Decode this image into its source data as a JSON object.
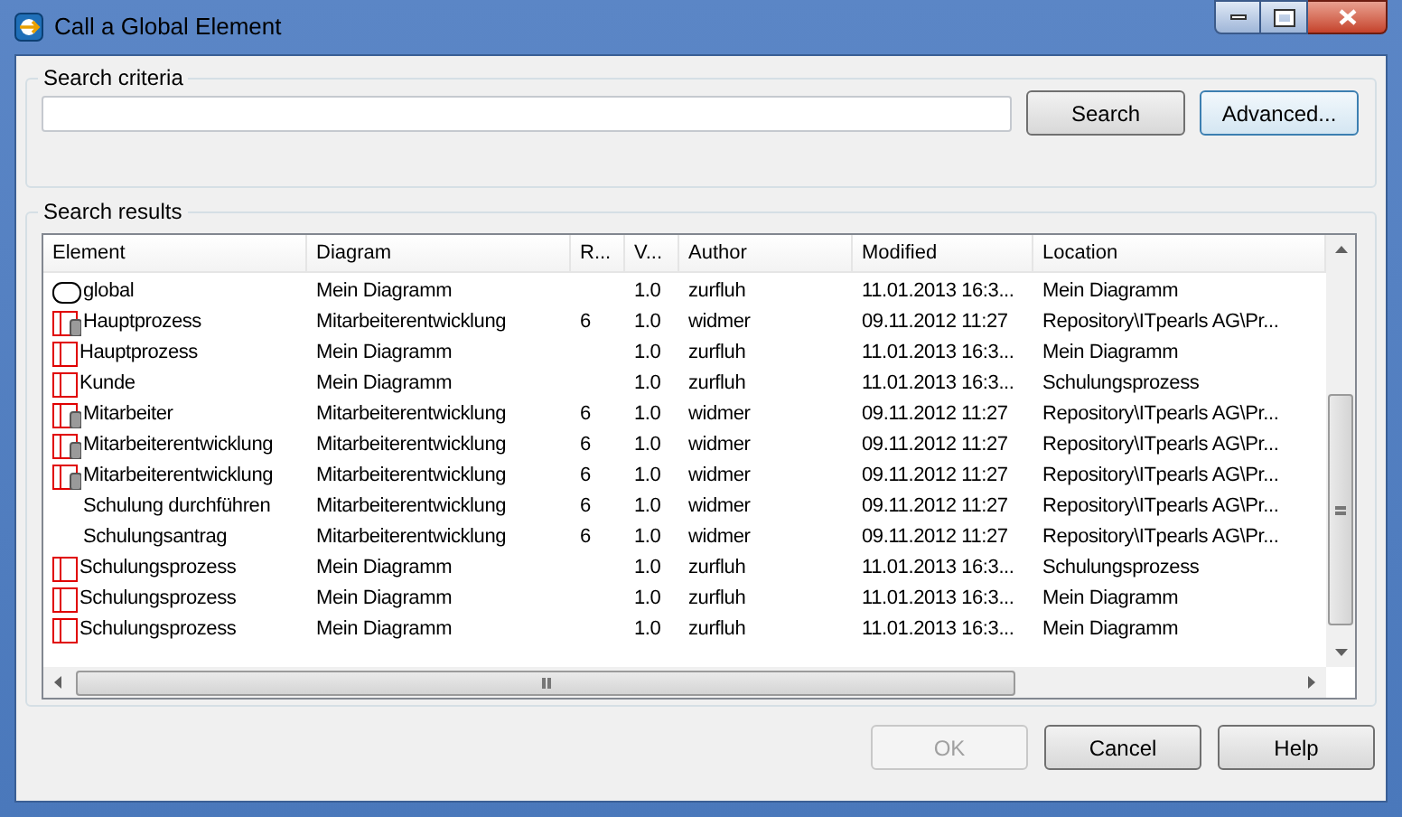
{
  "window": {
    "title": "Call a Global Element"
  },
  "search_criteria": {
    "label": "Search criteria",
    "search_button": "Search",
    "advanced_button": "Advanced..."
  },
  "search_results": {
    "label": "Search results",
    "columns": [
      "Element",
      "Diagram",
      "R...",
      "V...",
      "Author",
      "Modified",
      "Location"
    ],
    "rows": [
      {
        "kind": "terminator",
        "cells": [
          "global",
          "Mein Diagramm",
          "",
          "1.0",
          "zurfluh",
          "11.01.2013 16:3...",
          "Mein Diagramm"
        ]
      },
      {
        "kind": "linked-process",
        "cells": [
          "Hauptprozess",
          "Mitarbeiterentwicklung",
          "6",
          "1.0",
          "widmer",
          "09.11.2012 11:27",
          "Repository\\ITpearls AG\\Pr..."
        ]
      },
      {
        "kind": "process",
        "cells": [
          "Hauptprozess",
          "Mein Diagramm",
          "",
          "1.0",
          "zurfluh",
          "11.01.2013 16:3...",
          "Mein Diagramm"
        ]
      },
      {
        "kind": "process",
        "cells": [
          "Kunde",
          "Mein Diagramm",
          "",
          "1.0",
          "zurfluh",
          "11.01.2013 16:3...",
          "Schulungsprozess"
        ]
      },
      {
        "kind": "linked-process",
        "cells": [
          "Mitarbeiter",
          "Mitarbeiterentwicklung",
          "6",
          "1.0",
          "widmer",
          "09.11.2012 11:27",
          "Repository\\ITpearls AG\\Pr..."
        ]
      },
      {
        "kind": "linked-process",
        "cells": [
          "Mitarbeiterentwicklung",
          "Mitarbeiterentwicklung",
          "6",
          "1.0",
          "widmer",
          "09.11.2012 11:27",
          "Repository\\ITpearls AG\\Pr..."
        ]
      },
      {
        "kind": "linked-process",
        "cells": [
          "Mitarbeiterentwicklung",
          "Mitarbeiterentwicklung",
          "6",
          "1.0",
          "widmer",
          "09.11.2012 11:27",
          "Repository\\ITpearls AG\\Pr..."
        ]
      },
      {
        "kind": "none",
        "cells": [
          "Schulung durchführen",
          "Mitarbeiterentwicklung",
          "6",
          "1.0",
          "widmer",
          "09.11.2012 11:27",
          "Repository\\ITpearls AG\\Pr..."
        ]
      },
      {
        "kind": "none",
        "cells": [
          "Schulungsantrag",
          "Mitarbeiterentwicklung",
          "6",
          "1.0",
          "widmer",
          "09.11.2012 11:27",
          "Repository\\ITpearls AG\\Pr..."
        ]
      },
      {
        "kind": "process",
        "cells": [
          "Schulungsprozess",
          "Mein Diagramm",
          "",
          "1.0",
          "zurfluh",
          "11.01.2013 16:3...",
          "Schulungsprozess"
        ]
      },
      {
        "kind": "process",
        "cells": [
          "Schulungsprozess",
          "Mein Diagramm",
          "",
          "1.0",
          "zurfluh",
          "11.01.2013 16:3...",
          "Mein Diagramm"
        ]
      },
      {
        "kind": "process",
        "cells": [
          "Schulungsprozess",
          "Mein Diagramm",
          "",
          "1.0",
          "zurfluh",
          "11.01.2013 16:3...",
          "Mein Diagramm"
        ]
      }
    ]
  },
  "buttons": [
    {
      "label": "OK",
      "disabled": true
    },
    {
      "label": "Cancel",
      "disabled": false
    },
    {
      "label": "Help",
      "disabled": false
    }
  ]
}
